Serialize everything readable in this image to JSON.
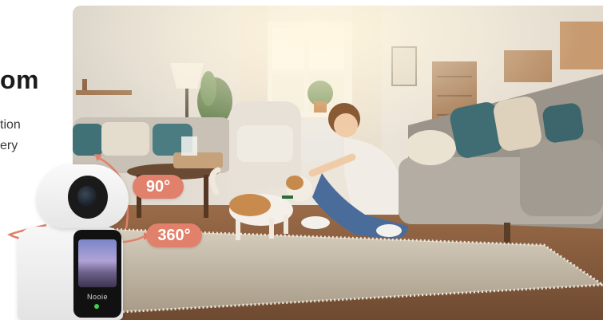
{
  "panel": {
    "heading": "om",
    "line1": "tion",
    "line2": "ery"
  },
  "badges": {
    "tilt": "90°",
    "pan": "360°"
  },
  "camera": {
    "brand": "Nooie"
  },
  "colors": {
    "badge": "#e1806b",
    "arrow": "#e1806b",
    "heading": "#1b1b1b"
  }
}
